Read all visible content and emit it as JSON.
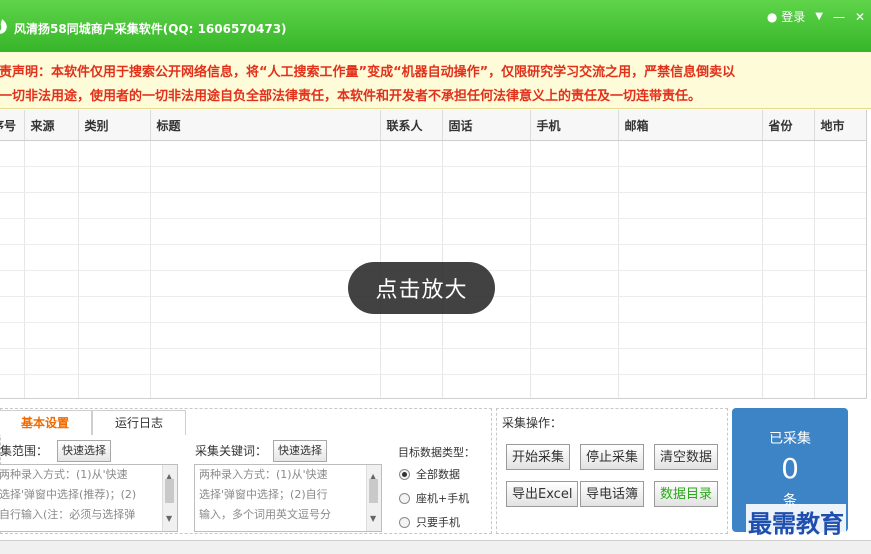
{
  "window": {
    "title": "风清扬58同城商户采集软件(QQ: 1606570473)",
    "login_label": "登录",
    "menu_glyph": "▼",
    "minimize_glyph": "—",
    "close_glyph": "✕"
  },
  "notice": {
    "line1": "免责声明：本软件仅用于搜索公开网络信息，将“人工搜索工作量”变成“机器自动操作”，仅限研究学习交流之用，严禁信息倒卖以",
    "line2": "及一切非法用途，使用者的一切非法用途自负全部法律责任，本软件和开发者不承担任何法律意义上的责任及一切连带责任。"
  },
  "table": {
    "columns": [
      "序号",
      "来源",
      "类别",
      "标题",
      "联系人",
      "固话",
      "手机",
      "邮箱",
      "省份",
      "地市"
    ]
  },
  "overlay": {
    "zoom_label": "点击放大"
  },
  "tabs": {
    "basic": "基本设置",
    "log": "运行日志"
  },
  "settings": {
    "range_label": "采集范围：",
    "range_button": "快速选择",
    "range_text": [
      "两种录入方式：(1)从'快速",
      "选择'弹窗中选择(推荐)；(2)",
      "自行输入(注：必须与选择弹"
    ],
    "keyword_label": "采集关键词：",
    "keyword_button": "快速选择",
    "keyword_text": [
      "两种录入方式：(1)从'快速",
      "选择'弹窗中选择；(2)自行",
      "输入，多个词用英文逗号分"
    ],
    "datatype_label": "目标数据类型：",
    "datatype_options": [
      "全部数据",
      "座机+手机",
      "只要手机"
    ],
    "datatype_selected": 0
  },
  "operations": {
    "label": "采集操作：",
    "start": "开始采集",
    "stop": "停止采集",
    "clear": "清空数据",
    "export_excel": "导出Excel",
    "export_phonebook": "导电话簿",
    "data_dir": "数据目录"
  },
  "counter": {
    "label": "已采集",
    "count": "0",
    "unit": "条"
  },
  "watermark": "最需教育"
}
